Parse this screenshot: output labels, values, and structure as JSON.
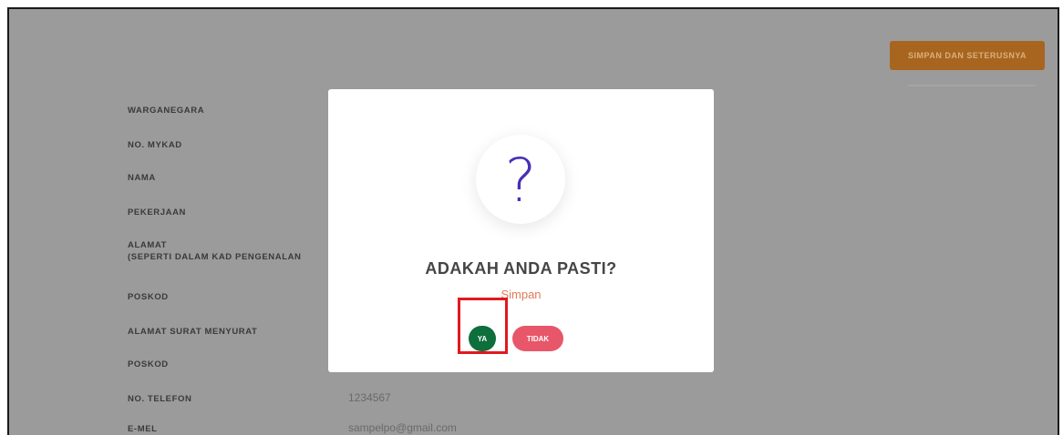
{
  "header": {
    "save_button_label": "SIMPAN DAN SETERUSNYA"
  },
  "form": {
    "labels": {
      "warganegara": "WARGANEGARA",
      "no_mykad": "NO. MYKAD",
      "nama": "NAMA",
      "pekerjaan": "PEKERJAAN",
      "alamat": "ALAMAT",
      "alamat_sub": "(SEPERTI DALAM KAD PENGENALAN",
      "poskod_1": "POSKOD",
      "alamat_surat": "ALAMAT SURAT MENYURAT",
      "poskod_2": "POSKOD",
      "no_telefon": "NO. TELEFON",
      "emel": "E-MEL"
    },
    "values": {
      "no_telefon": "1234567",
      "emel": "sampelpo@gmail.com"
    }
  },
  "dialog": {
    "icon": "question-mark-icon",
    "icon_glyph": "?",
    "title": "ADAKAH ANDA PASTI?",
    "subtitle": "Simpan",
    "confirm_label": "YA",
    "cancel_label": "TIDAK"
  },
  "colors": {
    "overlay": "#9b9b9b",
    "save_button": "#a8651f",
    "question_mark": "#4a2fb5",
    "confirm": "#0e6e3c",
    "cancel": "#e8566a",
    "highlight": "#e0191f"
  }
}
